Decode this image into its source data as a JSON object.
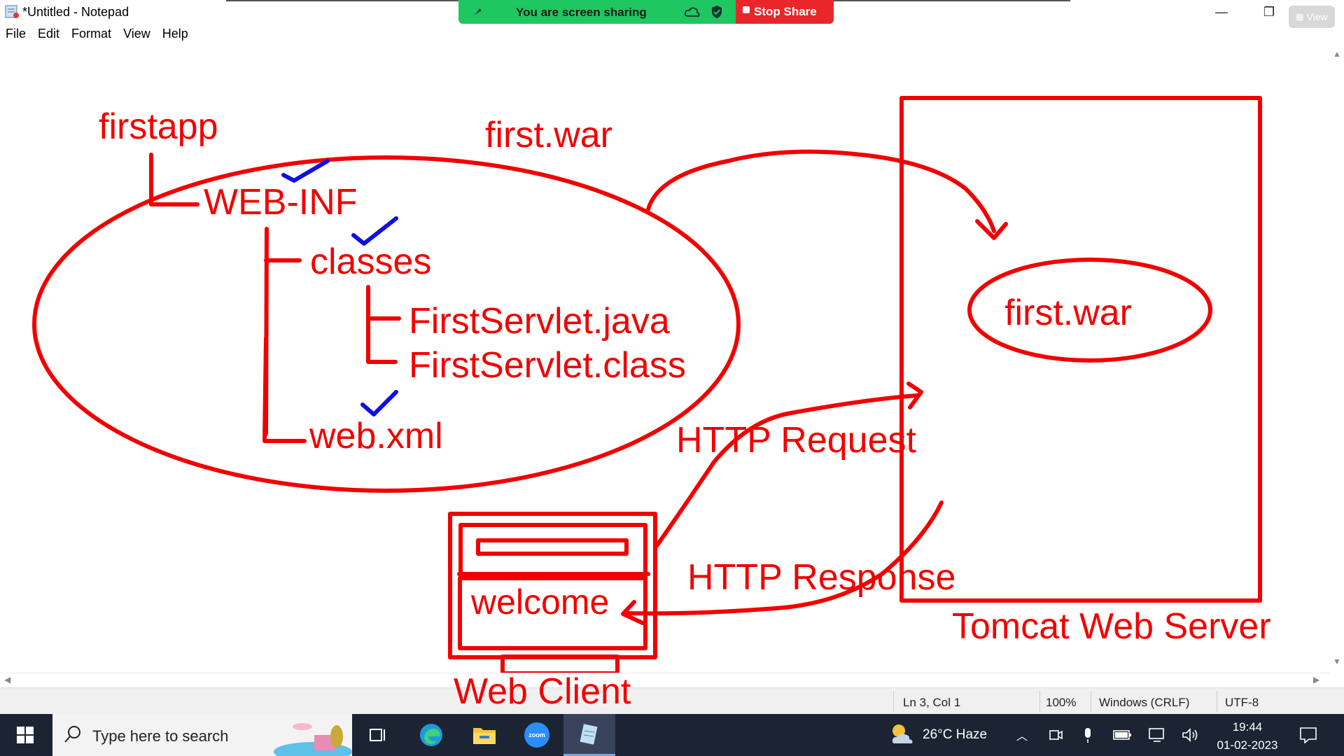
{
  "window": {
    "title": "*Untitled - Notepad",
    "menu": [
      "File",
      "Edit",
      "Format",
      "View",
      "Help"
    ],
    "controls": {
      "minimize": "—",
      "restore": "❐",
      "close": "✕"
    }
  },
  "share_banner": {
    "text": "You are screen sharing",
    "stop_label": "Stop Share",
    "view_label": "View"
  },
  "drawing": {
    "labels": {
      "firstapp": "firstapp",
      "first_war_top": "first.war",
      "web_inf": "WEB-INF",
      "classes": "classes",
      "servlet_java": "FirstServlet.java",
      "servlet_class": "FirstServlet.class",
      "web_xml": "web.xml",
      "server_war": "first.war",
      "http_request": "HTTP Request",
      "http_response": "HTTP Response",
      "tomcat": "Tomcat Web Server",
      "welcome": "welcome",
      "web_client": "Web Client"
    },
    "colors": {
      "ink": "#f20000",
      "check": "#1010e0"
    }
  },
  "status": {
    "position": "Ln 3, Col 1",
    "zoom": "100%",
    "line_ending": "Windows (CRLF)",
    "encoding": "UTF-8"
  },
  "taskbar": {
    "search_placeholder": "Type here to search",
    "weather": "26°C  Haze",
    "time": "19:44",
    "date": "01-02-2023",
    "zoom_label": "zoom"
  }
}
